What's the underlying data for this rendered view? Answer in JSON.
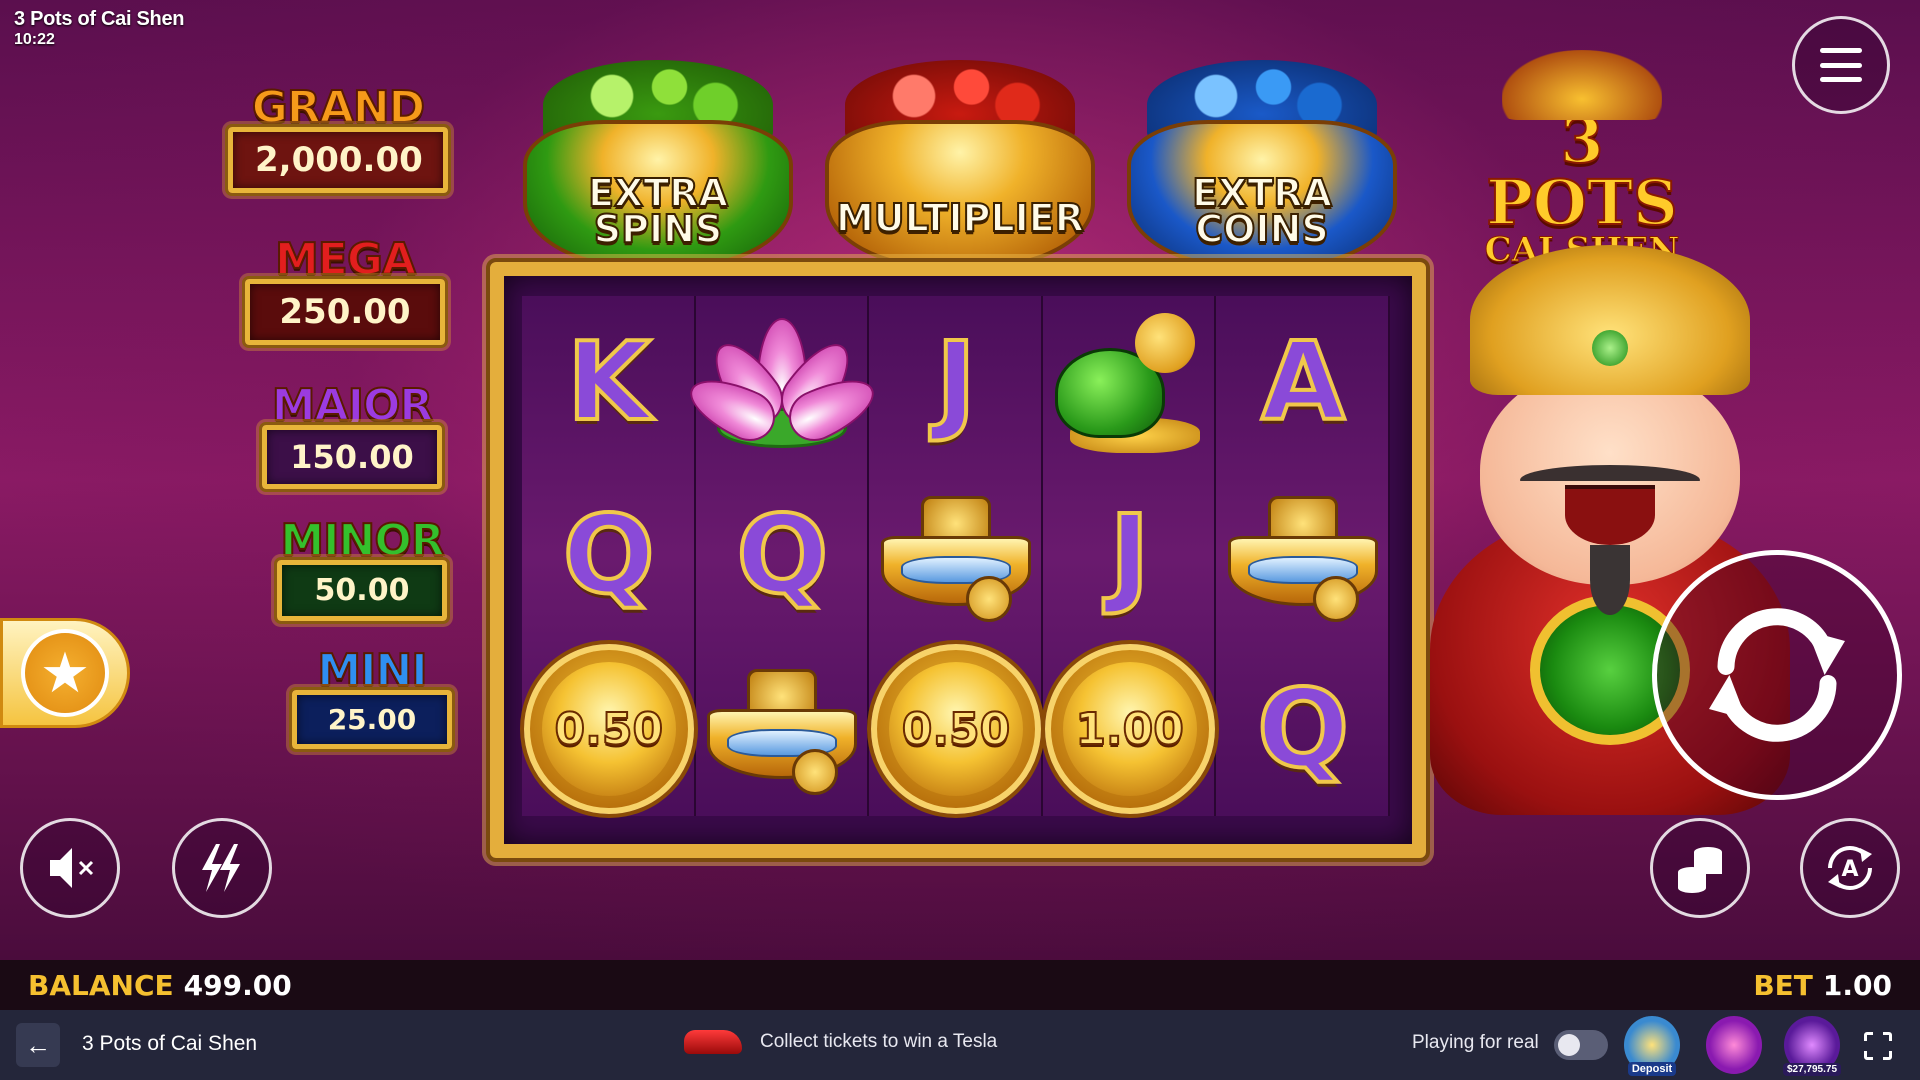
{
  "header": {
    "title": "3 Pots of Cai Shen",
    "time": "10:22"
  },
  "jackpots": [
    {
      "label": "GRAND",
      "value": "2,000.00"
    },
    {
      "label": "MEGA",
      "value": "250.00"
    },
    {
      "label": "MAJOR",
      "value": "150.00"
    },
    {
      "label": "MINOR",
      "value": "50.00"
    },
    {
      "label": "MINI",
      "value": "25.00"
    }
  ],
  "pots": [
    {
      "label_line1": "EXTRA",
      "label_line2": "SPINS",
      "color": "#2f9a12"
    },
    {
      "label_line1": "MULTIPLIER",
      "label_line2": "",
      "color": "#c81a10"
    },
    {
      "label_line1": "EXTRA",
      "label_line2": "COINS",
      "color": "#1a58c8"
    }
  ],
  "logo": {
    "line1": "3 POTS",
    "line2": "CAI SHEN"
  },
  "reels": {
    "row1": [
      "K",
      "lotus-icon",
      "J",
      "turtle-icon",
      "A"
    ],
    "row2": [
      "Q",
      "Q",
      "ingot-icon",
      "J",
      "ingot-icon"
    ],
    "row3": [
      "0.50",
      "ingot-icon",
      "0.50",
      "1.00",
      "Q"
    ]
  },
  "status": {
    "balance_label": "BALANCE",
    "balance_value": "499.00",
    "bet_label": "BET",
    "bet_value": "1.00"
  },
  "nav": {
    "back_icon": "arrow-left-icon",
    "title": "3 Pots of Cai Shen",
    "promo_text": "Collect tickets to win a Tesla",
    "playing_label": "Playing for real",
    "bonus_badge": "Deposit",
    "jackpot_badge": "$27,795.75"
  },
  "colors": {
    "accent_gold": "#f5c030",
    "nav_bg": "#24263a",
    "reel_bg": "#4a0e5a"
  }
}
